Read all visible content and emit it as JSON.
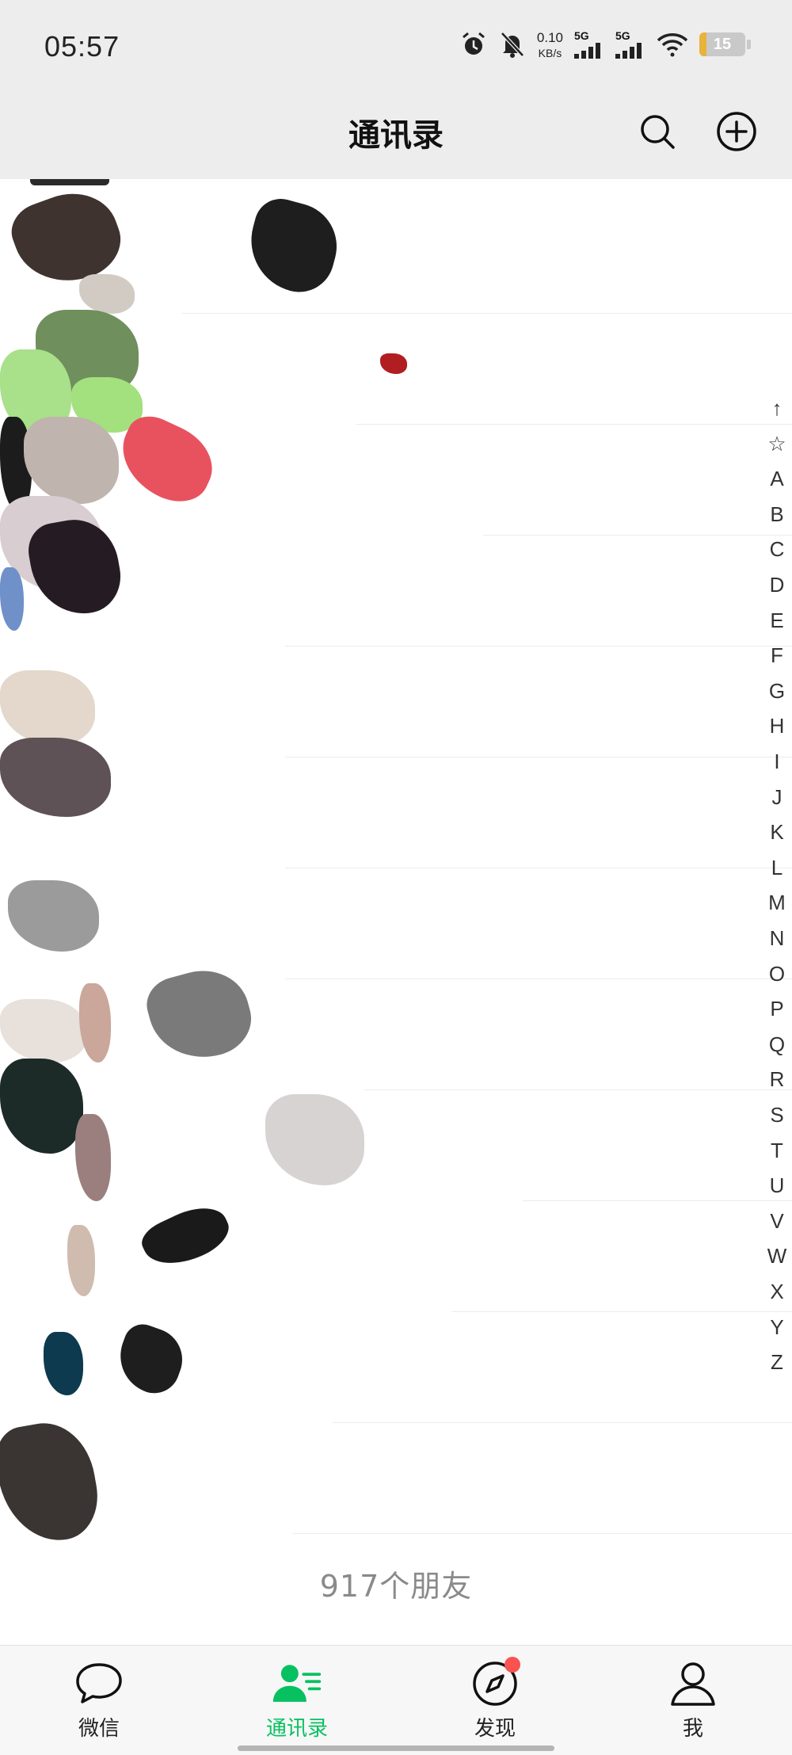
{
  "status_bar": {
    "time": "05:57",
    "net_speed_value": "0.10",
    "net_speed_unit": "KB/s",
    "signal1_label": "5G",
    "signal2_label": "5G",
    "battery_level": "15",
    "battery_fraction": 0.15,
    "icons": [
      "alarm-icon",
      "mute-bell-icon",
      "signal-icon",
      "signal-icon",
      "wifi-icon",
      "battery-icon"
    ]
  },
  "header": {
    "title": "通讯录",
    "search_icon": "search-icon",
    "add_icon": "add-circle-icon"
  },
  "contacts": {
    "friend_count": "917个朋友"
  },
  "index_bar": {
    "items": [
      "↑",
      "☆",
      "A",
      "B",
      "C",
      "D",
      "E",
      "F",
      "G",
      "H",
      "I",
      "J",
      "K",
      "L",
      "M",
      "N",
      "O",
      "P",
      "Q",
      "R",
      "S",
      "T",
      "U",
      "V",
      "W",
      "X",
      "Y",
      "Z",
      "#"
    ],
    "active": "#",
    "active_color": "#07c160"
  },
  "tabbar": {
    "tabs": [
      {
        "label": "微信",
        "icon": "chat-bubble-icon",
        "active": false
      },
      {
        "label": "通讯录",
        "icon": "contacts-icon",
        "active": true
      },
      {
        "label": "发现",
        "icon": "compass-icon",
        "active": false,
        "badge": true
      },
      {
        "label": "我",
        "icon": "person-icon",
        "active": false
      }
    ],
    "active_color": "#07c160",
    "badge_color": "#fa5151"
  }
}
